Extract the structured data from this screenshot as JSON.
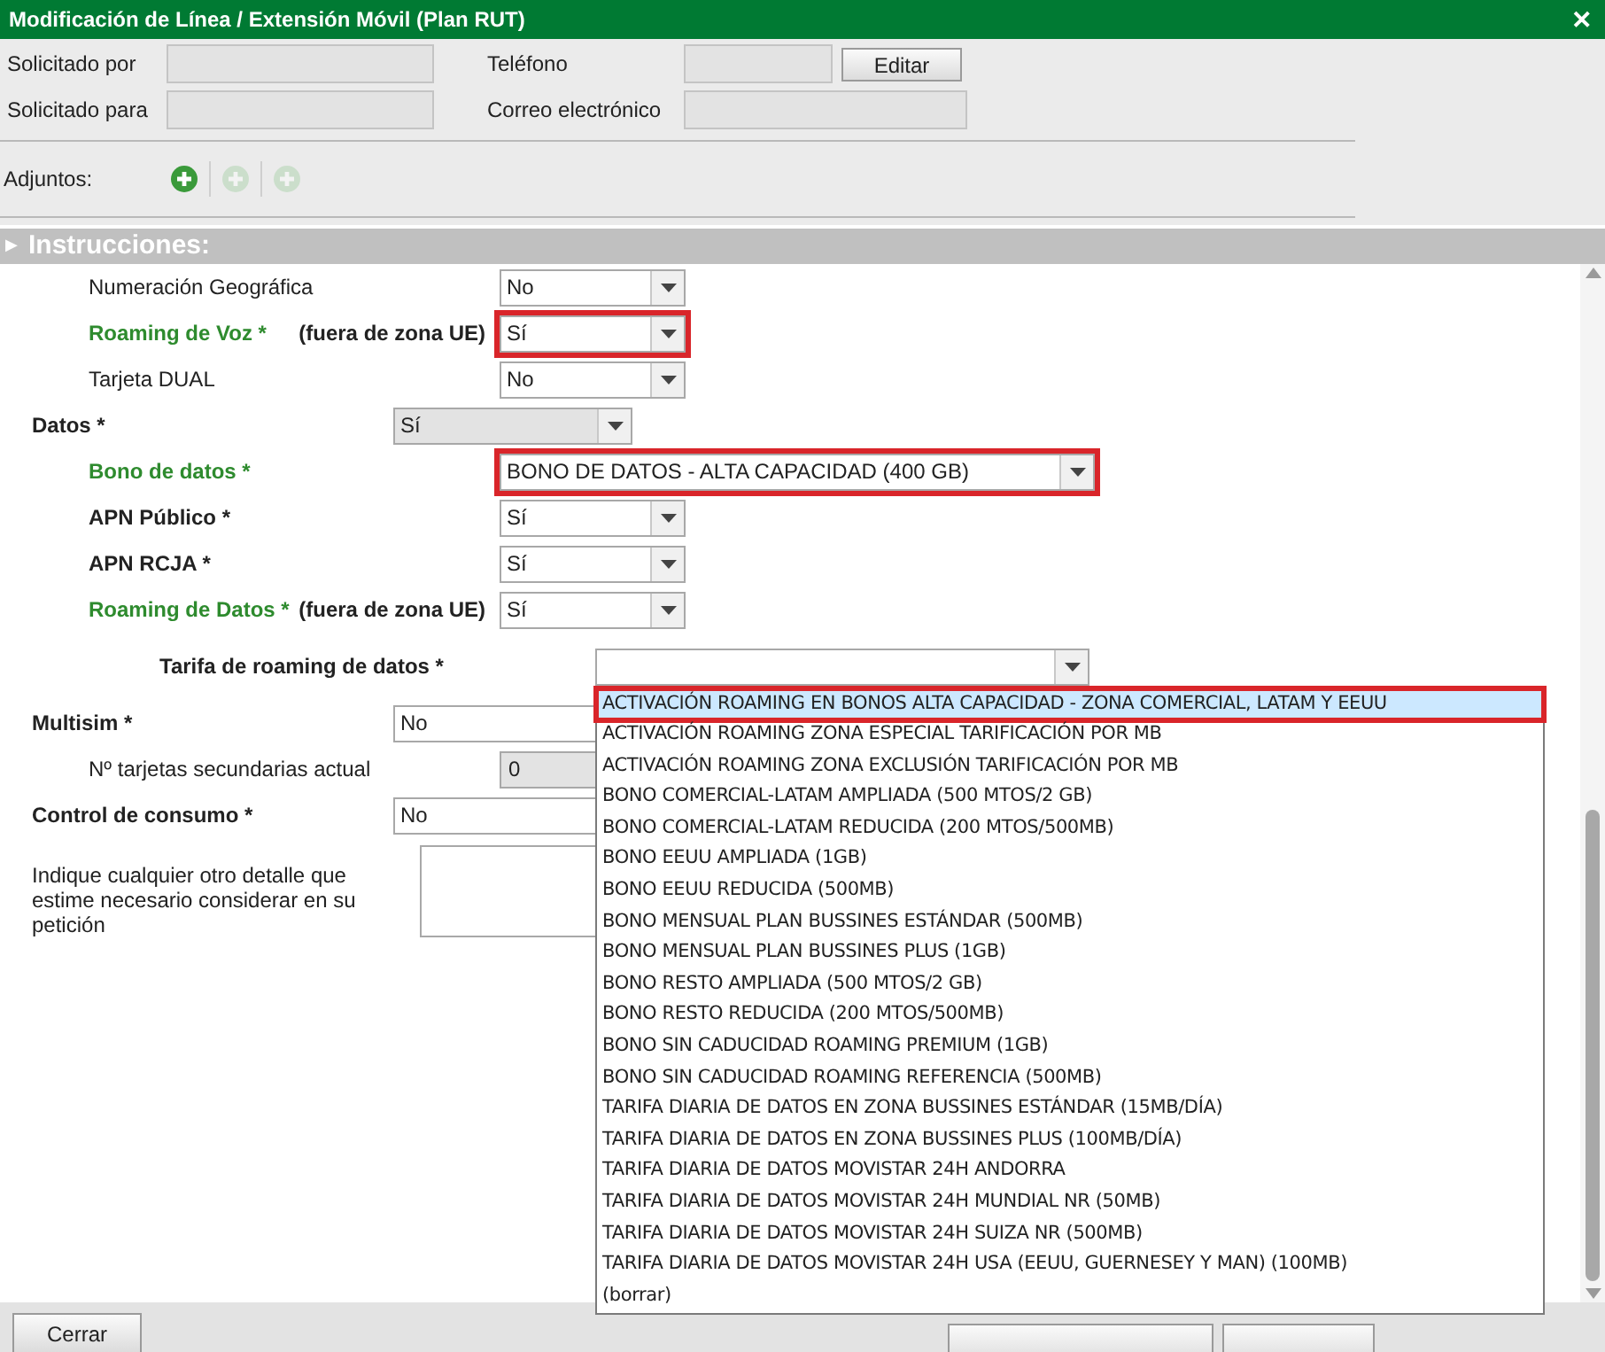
{
  "window": {
    "title": "Modificación de Línea / Extensión Móvil (Plan RUT)",
    "close": "✕"
  },
  "header": {
    "fields": [
      {
        "label": "Solicitado por"
      },
      {
        "label": "Teléfono"
      },
      {
        "label": "Solicitado para"
      },
      {
        "label": "Correo electrónico"
      }
    ],
    "edit_button": "Editar"
  },
  "attachments": {
    "label": "Adjuntos:",
    "buttons": [
      {
        "disabled": false
      },
      {
        "disabled": true
      },
      {
        "disabled": true
      }
    ]
  },
  "section": {
    "icon": "▶",
    "title": "Instrucciones:"
  },
  "items": [
    {
      "kind": "group",
      "children": [
        {
          "kind": "select",
          "label": "Numeración Geográfica",
          "bold": false,
          "emphasized": false,
          "value": "No",
          "marked": false
        },
        {
          "kind": "select",
          "label": "Roaming de Voz *",
          "bold": true,
          "emphasized": true,
          "note": "(fuera de zona UE)",
          "value": "Sí",
          "marked": true
        },
        {
          "kind": "select",
          "label": "Tarjeta DUAL",
          "bold": false,
          "emphasized": false,
          "value": "No",
          "marked": false
        }
      ]
    },
    {
      "kind": "select",
      "label": "Datos *",
      "bold": true,
      "emphasized": false,
      "value": "Sí",
      "disabled": true,
      "marked": false,
      "children": [
        {
          "kind": "select",
          "label": "Bono de datos *",
          "bold": true,
          "emphasized": true,
          "value": "BONO DE DATOS - ALTA CAPACIDAD (400 GB)",
          "marked": true
        },
        {
          "kind": "select",
          "label": "APN Público *",
          "bold": true,
          "emphasized": false,
          "value": "Sí",
          "marked": false
        },
        {
          "kind": "select",
          "label": "APN RCJA *",
          "bold": true,
          "emphasized": false,
          "value": "Sí",
          "marked": false
        },
        {
          "kind": "select",
          "label": "Roaming de Datos *",
          "bold": true,
          "emphasized": true,
          "note": "(fuera de zona UE)",
          "value": "Sí",
          "marked": false,
          "children": [
            {
              "kind": "select",
              "label": "Tarifa de roaming de datos *",
              "bold": true,
              "emphasized": false,
              "marked": false,
              "expanded": true,
              "options": [
                {
                  "label": "ACTIVACIÓN ROAMING EN BONOS ALTA CAPACIDAD - ZONA COMERCIAL, LATAM Y EEUU",
                  "selected": true,
                  "marked": true
                },
                {
                  "label": "ACTIVACIÓN ROAMING ZONA ESPECIAL TARIFICACIÓN POR MB",
                  "selected": false,
                  "marked": false
                },
                {
                  "label": "ACTIVACIÓN ROAMING ZONA EXCLUSIÓN TARIFICACIÓN POR MB",
                  "selected": false,
                  "marked": false
                },
                {
                  "label": "BONO COMERCIAL-LATAM AMPLIADA (500 MTOS/2 GB)",
                  "selected": false,
                  "marked": false
                },
                {
                  "label": "BONO COMERCIAL-LATAM REDUCIDA (200 MTOS/500MB)",
                  "selected": false,
                  "marked": false
                },
                {
                  "label": "BONO EEUU AMPLIADA (1GB)",
                  "selected": false,
                  "marked": false
                },
                {
                  "label": "BONO EEUU REDUCIDA (500MB)",
                  "selected": false,
                  "marked": false
                },
                {
                  "label": "BONO MENSUAL PLAN BUSSINES ESTÁNDAR (500MB)",
                  "selected": false,
                  "marked": false
                },
                {
                  "label": "BONO MENSUAL PLAN BUSSINES PLUS (1GB)",
                  "selected": false,
                  "marked": false
                },
                {
                  "label": "BONO RESTO AMPLIADA (500 MTOS/2 GB)",
                  "selected": false,
                  "marked": false
                },
                {
                  "label": "BONO RESTO REDUCIDA (200 MTOS/500MB)",
                  "selected": false,
                  "marked": false
                },
                {
                  "label": "BONO SIN CADUCIDAD ROAMING PREMIUM (1GB)",
                  "selected": false,
                  "marked": false
                },
                {
                  "label": "BONO SIN CADUCIDAD ROAMING REFERENCIA (500MB)",
                  "selected": false,
                  "marked": false
                },
                {
                  "label": "TARIFA DIARIA DE DATOS EN ZONA BUSSINES ESTÁNDAR (15MB/DÍA)",
                  "selected": false,
                  "marked": false
                },
                {
                  "label": "TARIFA DIARIA DE DATOS EN ZONA BUSSINES PLUS (100MB/DÍA)",
                  "selected": false,
                  "marked": false
                },
                {
                  "label": "TARIFA DIARIA DE DATOS MOVISTAR 24H ANDORRA",
                  "selected": false,
                  "marked": false
                },
                {
                  "label": "TARIFA DIARIA DE DATOS MOVISTAR 24H MUNDIAL NR (50MB)",
                  "selected": false,
                  "marked": false
                },
                {
                  "label": "TARIFA DIARIA DE DATOS MOVISTAR 24H SUIZA NR (500MB)",
                  "selected": false,
                  "marked": false
                },
                {
                  "label": "TARIFA DIARIA DE DATOS MOVISTAR 24H USA (EEUU, GUERNESEY Y MAN) (100MB)",
                  "selected": false,
                  "marked": false
                },
                {
                  "label": "(borrar)",
                  "selected": false,
                  "marked": false
                }
              ]
            }
          ]
        }
      ]
    },
    {
      "kind": "select",
      "label": "Multisim *",
      "bold": true,
      "emphasized": false,
      "value": "No",
      "marked": false,
      "children": [
        {
          "kind": "number",
          "label": "Nº tarjetas secundarias actual",
          "bold": false,
          "emphasized": false,
          "value": "0"
        }
      ]
    },
    {
      "kind": "select",
      "label": "Control de consumo *",
      "bold": true,
      "emphasized": false,
      "value": "No",
      "marked": false
    },
    {
      "kind": "textarea",
      "label": "Indique cualquier otro detalle que estime necesario considerar en su petición",
      "bold": false,
      "emphasized": false
    }
  ],
  "footer": {
    "close_button": "Cerrar",
    "other_buttons": [
      {
        "kind": "button"
      },
      {
        "kind": "button"
      }
    ]
  }
}
